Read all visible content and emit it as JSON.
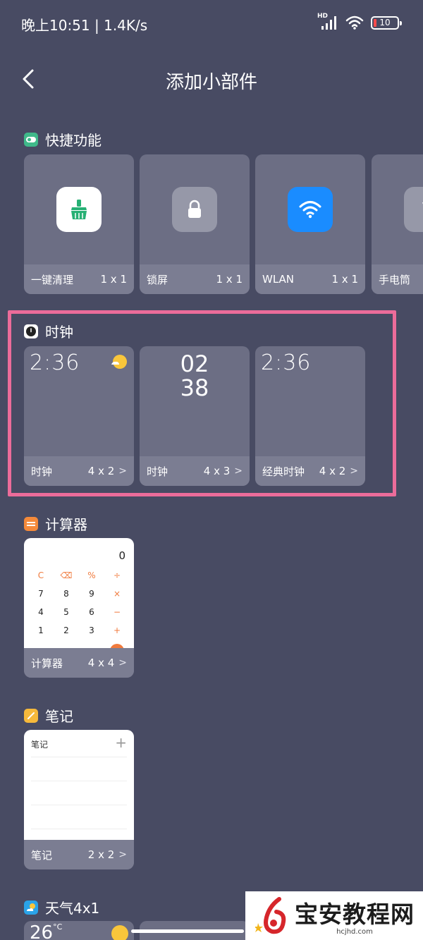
{
  "status_bar": {
    "time": "晚上10:51 | 1.4K/s",
    "network_badge": "HD",
    "battery": "10",
    "icons": [
      "hd-signal-icon",
      "wifi-icon",
      "battery-icon"
    ]
  },
  "header": {
    "title": "添加小部件",
    "back_icon": "chevron-left-icon"
  },
  "sections": {
    "quick": {
      "title": "快捷功能",
      "icon_color": "#3fb98a",
      "cards": [
        {
          "label": "一键清理",
          "size": "1 x 1",
          "icon": "broom-icon",
          "icon_bg": "#ffffff"
        },
        {
          "label": "锁屏",
          "size": "1 x 1",
          "icon": "lock-icon",
          "icon_bg": "#9698a8"
        },
        {
          "label": "WLAN",
          "size": "1 x 1",
          "icon": "wifi-icon",
          "icon_bg": "#1a8cff"
        },
        {
          "label": "手电筒",
          "size": "",
          "icon": "flashlight-icon",
          "icon_bg": "#9698a8"
        }
      ]
    },
    "clock": {
      "title": "时钟",
      "cards": [
        {
          "label": "时钟",
          "size": "4 x 2",
          "display": "2:36"
        },
        {
          "label": "时钟",
          "size": "4 x 3",
          "display_hours": "02",
          "display_minutes": "38"
        },
        {
          "label": "经典时钟",
          "size": "4 x 2",
          "display": "2:36"
        }
      ]
    },
    "calculator": {
      "title": "计算器",
      "icon_color": "#f58a3a",
      "card": {
        "label": "计算器",
        "size": "4 x 4",
        "display": "0"
      },
      "keys": [
        {
          "k": "C",
          "op": true
        },
        {
          "k": "⌫",
          "op": true
        },
        {
          "k": "%",
          "op": true
        },
        {
          "k": "÷",
          "op": true
        },
        {
          "k": "7",
          "op": false
        },
        {
          "k": "8",
          "op": false
        },
        {
          "k": "9",
          "op": false
        },
        {
          "k": "×",
          "op": true
        },
        {
          "k": "4",
          "op": false
        },
        {
          "k": "5",
          "op": false
        },
        {
          "k": "6",
          "op": false
        },
        {
          "k": "−",
          "op": true
        },
        {
          "k": "1",
          "op": false
        },
        {
          "k": "2",
          "op": false
        },
        {
          "k": "3",
          "op": false
        },
        {
          "k": "+",
          "op": true
        }
      ]
    },
    "notes": {
      "title": "笔记",
      "icon_color": "#f6b93b",
      "card": {
        "label": "笔记",
        "size": "2 x 2",
        "inner_title": "笔记",
        "plus": "+"
      }
    },
    "weather": {
      "title": "天气4x1",
      "icon_color": "#2aa3e8",
      "temp": "26",
      "unit": "°C"
    }
  },
  "watermark": {
    "title": "宝安教程网",
    "url": "hcjhd.com"
  },
  "colors": {
    "background": "#484b63",
    "card": "#6c6e84",
    "card_footer": "#7b7d92",
    "highlight": "#ec6c9a"
  }
}
